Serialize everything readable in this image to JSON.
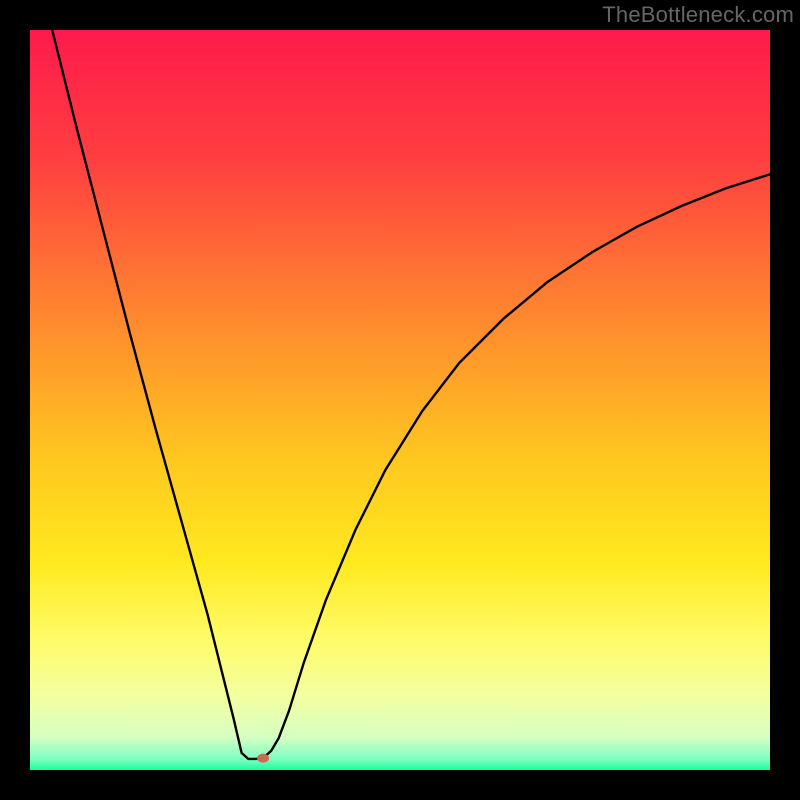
{
  "watermark": "TheBottleneck.com",
  "chart_data": {
    "type": "line",
    "title": "",
    "xlabel": "",
    "ylabel": "",
    "xlim": [
      0,
      100
    ],
    "ylim": [
      0,
      100
    ],
    "gradient_stops": [
      {
        "offset": 0.0,
        "color": "#ff1a4b"
      },
      {
        "offset": 0.18,
        "color": "#ff4040"
      },
      {
        "offset": 0.4,
        "color": "#ff8c2e"
      },
      {
        "offset": 0.58,
        "color": "#ffc71f"
      },
      {
        "offset": 0.72,
        "color": "#ffe91f"
      },
      {
        "offset": 0.82,
        "color": "#fffb66"
      },
      {
        "offset": 0.9,
        "color": "#f4ffa0"
      },
      {
        "offset": 0.955,
        "color": "#d6ffc2"
      },
      {
        "offset": 0.985,
        "color": "#7fffc2"
      },
      {
        "offset": 1.0,
        "color": "#1bff9e"
      }
    ],
    "series": [
      {
        "name": "bottleneck-curve",
        "points": [
          {
            "x": 3.0,
            "y": 100.0
          },
          {
            "x": 6.5,
            "y": 86.0
          },
          {
            "x": 10.0,
            "y": 72.5
          },
          {
            "x": 13.5,
            "y": 59.0
          },
          {
            "x": 17.0,
            "y": 46.0
          },
          {
            "x": 20.5,
            "y": 33.5
          },
          {
            "x": 24.0,
            "y": 21.0
          },
          {
            "x": 26.0,
            "y": 13.0
          },
          {
            "x": 27.5,
            "y": 7.0
          },
          {
            "x": 28.6,
            "y": 2.3
          },
          {
            "x": 29.5,
            "y": 1.5
          },
          {
            "x": 30.6,
            "y": 1.5
          },
          {
            "x": 31.7,
            "y": 1.8
          },
          {
            "x": 32.6,
            "y": 2.6
          },
          {
            "x": 33.6,
            "y": 4.3
          },
          {
            "x": 35.0,
            "y": 8.0
          },
          {
            "x": 37.0,
            "y": 14.5
          },
          {
            "x": 40.0,
            "y": 23.0
          },
          {
            "x": 44.0,
            "y": 32.5
          },
          {
            "x": 48.0,
            "y": 40.5
          },
          {
            "x": 53.0,
            "y": 48.5
          },
          {
            "x": 58.0,
            "y": 55.0
          },
          {
            "x": 64.0,
            "y": 61.0
          },
          {
            "x": 70.0,
            "y": 66.0
          },
          {
            "x": 76.0,
            "y": 70.0
          },
          {
            "x": 82.0,
            "y": 73.4
          },
          {
            "x": 88.0,
            "y": 76.2
          },
          {
            "x": 94.0,
            "y": 78.6
          },
          {
            "x": 100.0,
            "y": 80.5
          }
        ]
      }
    ],
    "marker": {
      "x": 31.5,
      "y": 1.6,
      "color": "#cc6b55"
    }
  }
}
